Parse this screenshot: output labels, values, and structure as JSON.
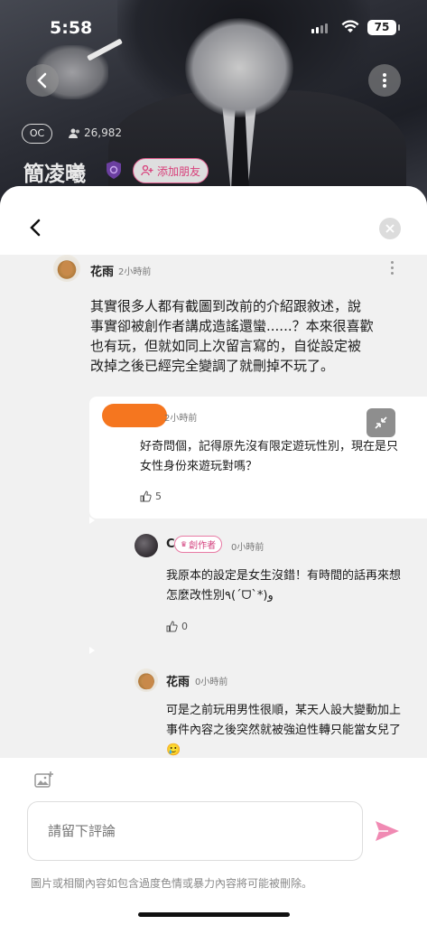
{
  "status_bar": {
    "time": "5:58",
    "battery": "75"
  },
  "profile": {
    "badge": "OC",
    "followers": "26,982",
    "name": "簡凌曦",
    "add_friend": "添加朋友"
  },
  "main_comment": {
    "author": "花雨",
    "time": "2小時前",
    "lines": [
      "其實很多人都有截圖到改前的介紹跟敘述，說",
      "事實卻被創作者講成造謠還蠻......？本來很喜歡",
      "也有玩，但就如同上次留言寫的，自從設定被",
      "改掉之後已經完全變調了就刪掉不玩了。"
    ]
  },
  "replies": [
    {
      "author": "",
      "time": "2小時前",
      "lines": [
        "好奇問個，記得原先沒有限定遊玩性別，現在是只",
        "女性身份來遊玩對嗎？"
      ],
      "likes": "5"
    },
    {
      "author": "C",
      "badge": "創作者",
      "time": "0小時前",
      "lines": [
        "我原本的設定是女生沒錯！有時間的話再來想",
        "怎麼改性別٩(ˊᗜˋ*)و"
      ],
      "likes": "0"
    },
    {
      "author": "花雨",
      "time": "0小時前",
      "lines": [
        "可是之前玩用男性很順，某天人設大變動加上",
        "事件內容之後突然就被強迫性轉只能當女兒了",
        "🥲"
      ]
    }
  ],
  "composer": {
    "placeholder": "請留下評論",
    "notice": "圖片或相關內容如包含過度色情或暴力內容將可能被刪除。"
  },
  "colors": {
    "accent": "#e8548f",
    "send": "#f08ab3"
  }
}
